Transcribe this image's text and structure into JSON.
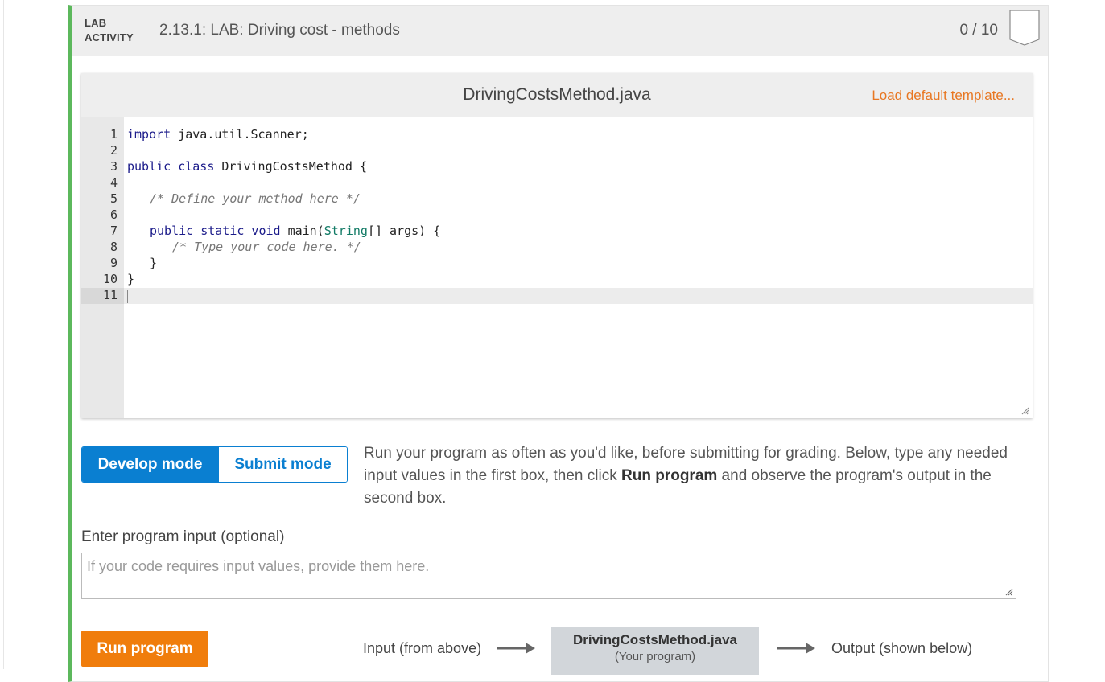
{
  "header": {
    "tag_line1": "LAB",
    "tag_line2": "ACTIVITY",
    "title": "2.13.1: LAB: Driving cost - methods",
    "score": "0 / 10",
    "accent_color": "#5cb85c"
  },
  "editor": {
    "filename": "DrivingCostsMethod.java",
    "load_template": "Load default template...",
    "line_numbers": [
      "1",
      "2",
      "3",
      "4",
      "5",
      "6",
      "7",
      "8",
      "9",
      "10",
      "11"
    ],
    "lines": {
      "l1_kw": "import",
      "l1_rest": " java.util.Scanner;",
      "l3_kw": "public class",
      "l3_rest": " DrivingCostsMethod {",
      "l5_comment": "/* Define your method here */",
      "l7_kw": "public static void",
      "l7_mid": " main(",
      "l7_type": "String",
      "l7_rest": "[] args) {",
      "l8_comment": "/* Type your code here. */",
      "l9": "}",
      "l10": "}"
    }
  },
  "modes": {
    "develop": "Develop mode",
    "submit": "Submit mode",
    "active": "develop",
    "active_color": "#0a7fd1",
    "description_part1": "Run your program as often as you'd like, before submitting for grading. Below, type any needed input values in the first box, then click ",
    "description_bold": "Run program",
    "description_part2": " and observe the program's output in the second box."
  },
  "input": {
    "label": "Enter program input (optional)",
    "placeholder": "If your code requires input values, provide them here.",
    "value": ""
  },
  "run": {
    "button_label": "Run program",
    "button_color": "#f07d0c",
    "flow_input": "Input (from above)",
    "program_name": "DrivingCostsMethod.java",
    "program_sub": "(Your program)",
    "flow_output": "Output (shown below)"
  }
}
